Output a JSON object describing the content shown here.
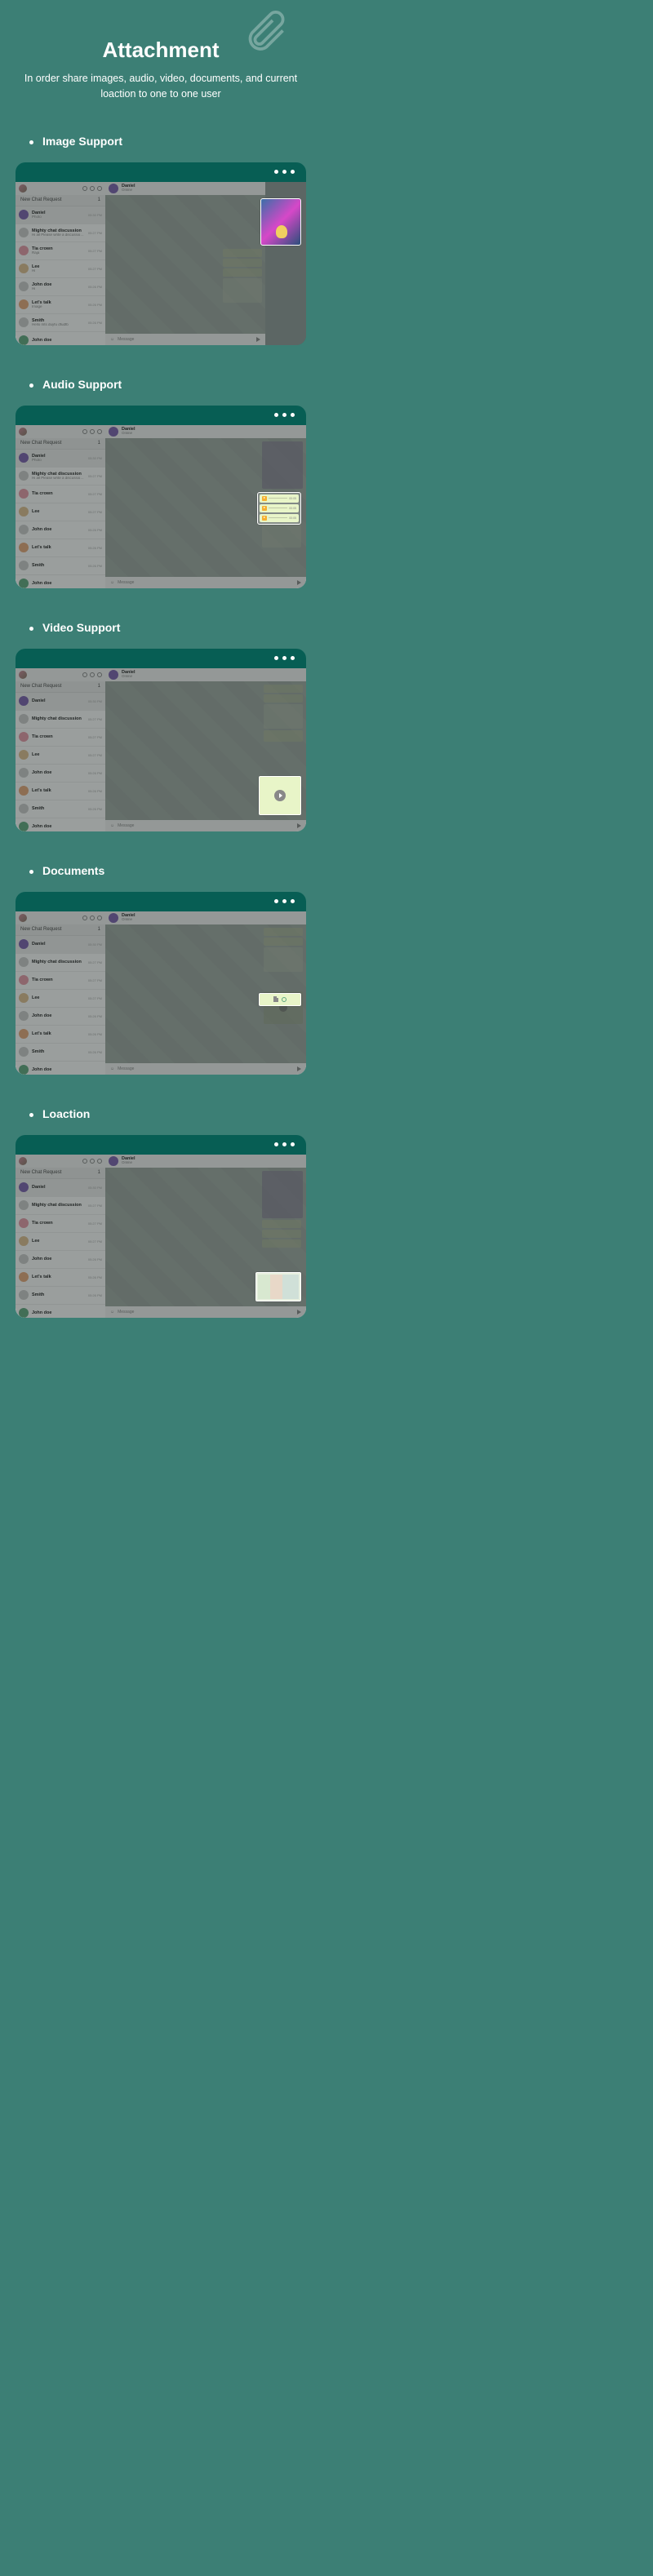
{
  "page": {
    "title": "Attachment",
    "subtitle": "In order share images, audio, video, documents, and current loaction to one to one user"
  },
  "sections": [
    {
      "label": "Image Support"
    },
    {
      "label": "Audio Support"
    },
    {
      "label": "Video Support"
    },
    {
      "label": "Documents"
    },
    {
      "label": "Loaction"
    }
  ],
  "chat_app": {
    "new_chat_label": "New Chat Request",
    "new_chat_badge": "1",
    "active_contact": {
      "name": "Daniel",
      "status": "Online"
    },
    "message_placeholder": "Message",
    "contacts": [
      {
        "name": "Daniel",
        "preview": "Photo",
        "time": "05:30 PM",
        "avatar": "av-purple"
      },
      {
        "name": "Mighty chat discussion",
        "preview": "Hi all Please write a discussion wh",
        "time": "05:27 PM",
        "avatar": "av-default"
      },
      {
        "name": "Tia crown",
        "preview": "Raja",
        "time": "05:27 PM",
        "avatar": "av-pink"
      },
      {
        "name": "Lee",
        "preview": "Hi",
        "time": "05:27 PM",
        "avatar": "av-tan"
      },
      {
        "name": "John doe",
        "preview": "Hi",
        "time": "05:26 PM",
        "avatar": "av-default"
      },
      {
        "name": "Let's talk",
        "preview": "Image",
        "time": "05:26 PM",
        "avatar": "av-orange"
      },
      {
        "name": "Smith",
        "preview": "Hello mts duyfu dfudfb",
        "time": "05:26 PM",
        "avatar": "av-default"
      },
      {
        "name": "John doe",
        "preview": "",
        "time": "",
        "avatar": "av-green"
      }
    ]
  },
  "audio": {
    "time": "00:05"
  }
}
